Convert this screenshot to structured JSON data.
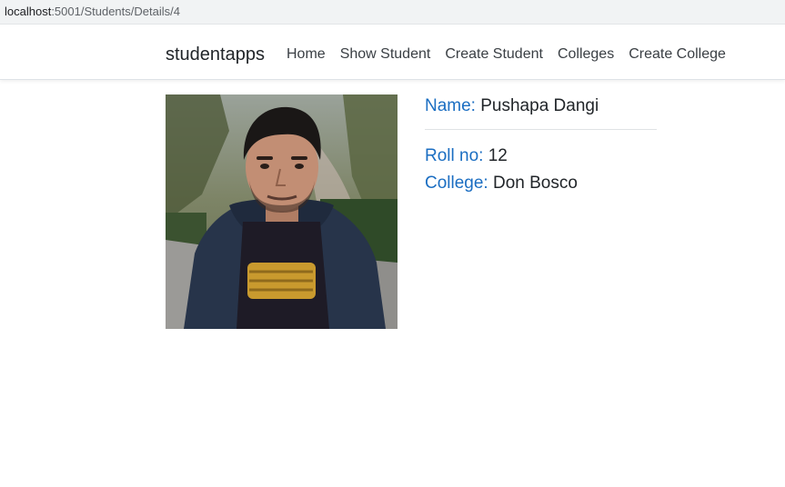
{
  "browser": {
    "url_host": "localhost",
    "url_path": ":5001/Students/Details/4"
  },
  "navbar": {
    "brand": "studentapps",
    "links": [
      "Home",
      "Show Student",
      "Create Student",
      "Colleges",
      "Create College"
    ]
  },
  "student": {
    "name_label": "Name:",
    "name_value": "Pushapa Dangi",
    "roll_label": "Roll no:",
    "roll_value": "12",
    "college_label": "College:",
    "college_value": "Don Bosco"
  },
  "colors": {
    "label": "#1b6ec2",
    "text": "#212529",
    "background": "#ffffff"
  }
}
